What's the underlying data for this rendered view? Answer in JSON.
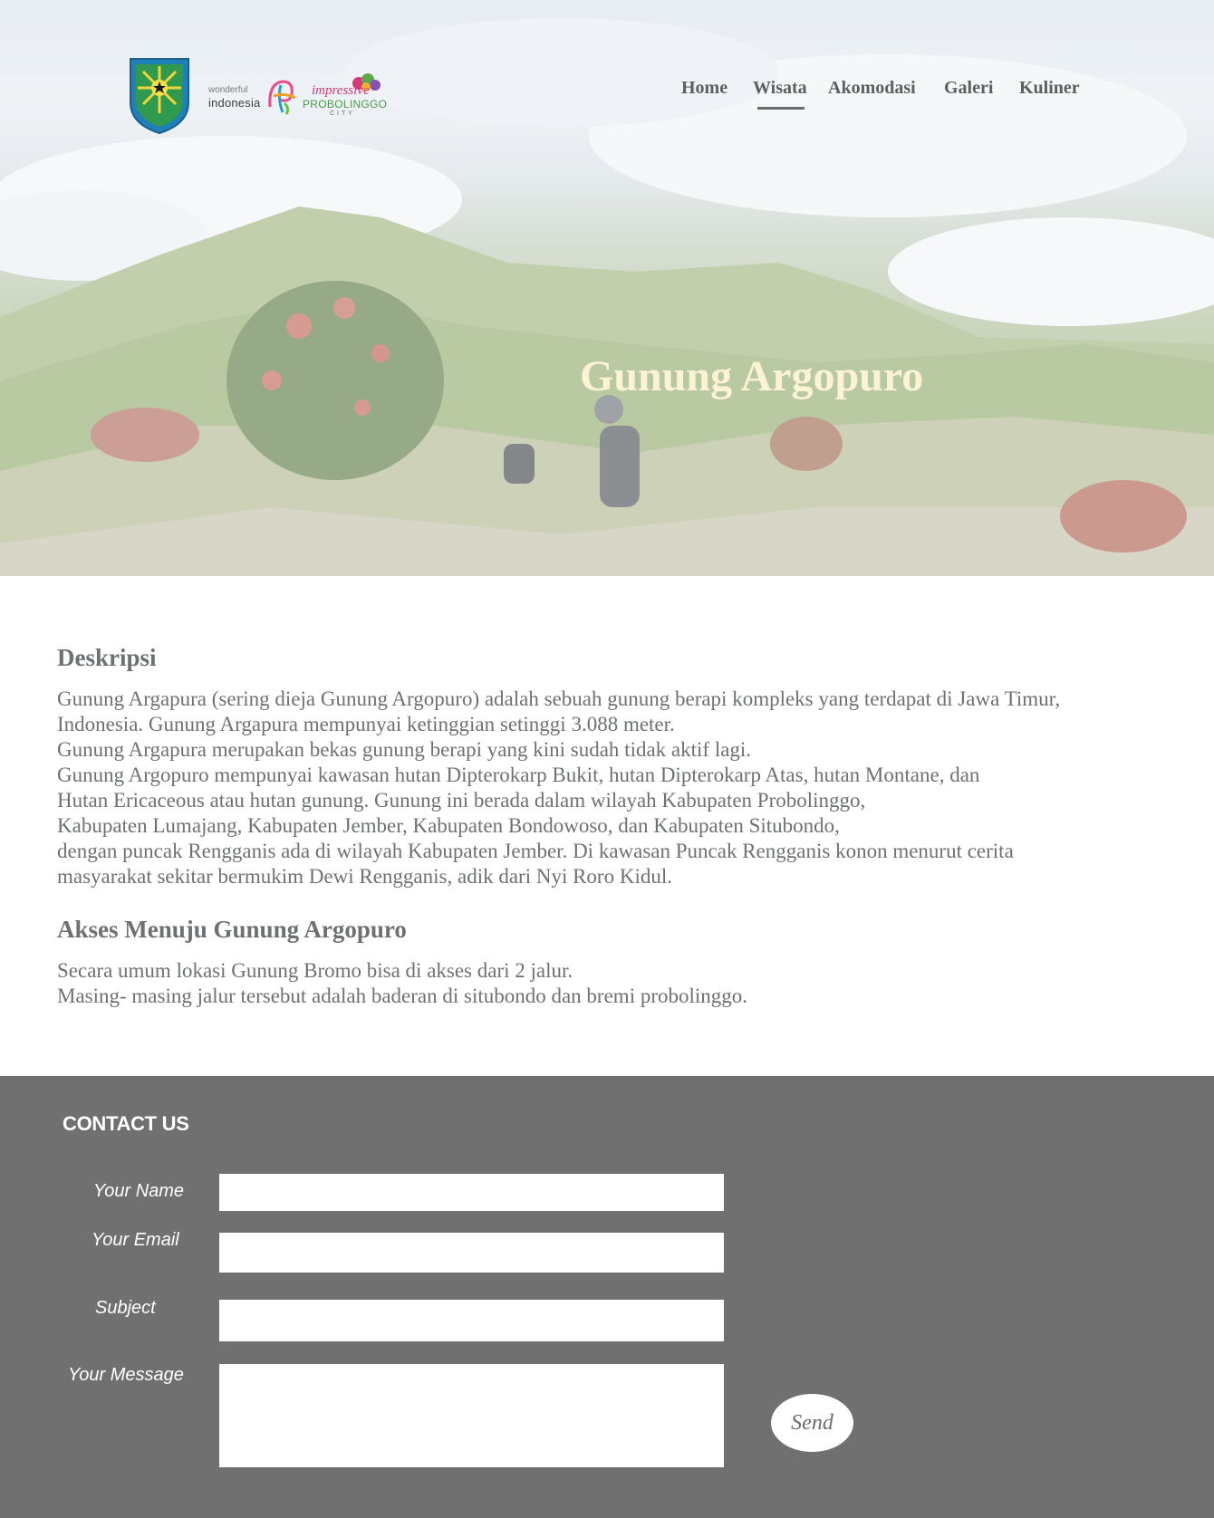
{
  "header": {
    "logos": {
      "wonderful_small": "wonderful",
      "wonderful_big": "indonesia",
      "impressive": "impressive",
      "probolinggo": "PROBOLINGGO",
      "city": "CITY"
    },
    "nav": [
      {
        "label": "Home"
      },
      {
        "label": "Wisata",
        "active": true
      },
      {
        "label": "Akomodasi"
      },
      {
        "label": "Galeri"
      },
      {
        "label": "Kuliner"
      }
    ]
  },
  "hero": {
    "title": "Gunung Argopuro"
  },
  "content": {
    "section1_heading": "Deskripsi",
    "section1_lines": [
      "Gunung Argapura (sering dieja Gunung Argopuro) adalah sebuah gunung berapi kompleks yang terdapat di Jawa Timur,",
      "Indonesia. Gunung Argapura mempunyai ketinggian setinggi 3.088 meter.",
      "Gunung Argapura merupakan bekas gunung berapi yang kini sudah tidak aktif lagi.",
      "Gunung Argopuro mempunyai kawasan hutan Dipterokarp Bukit, hutan Dipterokarp Atas, hutan Montane, dan",
      "Hutan Ericaceous atau hutan gunung. Gunung ini berada dalam wilayah Kabupaten Probolinggo,",
      "Kabupaten Lumajang, Kabupaten Jember, Kabupaten Bondowoso, dan Kabupaten Situbondo,",
      "dengan puncak Rengganis ada di wilayah Kabupaten Jember. Di kawasan Puncak Rengganis konon menurut cerita",
      "masyarakat sekitar bermukim Dewi Rengganis, adik dari Nyi Roro Kidul."
    ],
    "section2_heading": "Akses Menuju Gunung Argopuro",
    "section2_lines": [
      "Secara umum lokasi Gunung Bromo bisa di akses dari 2 jalur.",
      "Masing- masing jalur tersebut adalah baderan di situbondo dan bremi probolinggo."
    ]
  },
  "contact": {
    "heading": "CONTACT US",
    "name_label": "Your Name",
    "email_label": "Your Email",
    "subject_label": "Subject",
    "message_label": "Your Message",
    "name_value": "",
    "email_value": "",
    "subject_value": "",
    "message_value": "",
    "send_label": "Send"
  },
  "colors": {
    "footer_bg": "#707070",
    "hero_title": "#fbf3d4",
    "body_text": "#6e7173"
  }
}
